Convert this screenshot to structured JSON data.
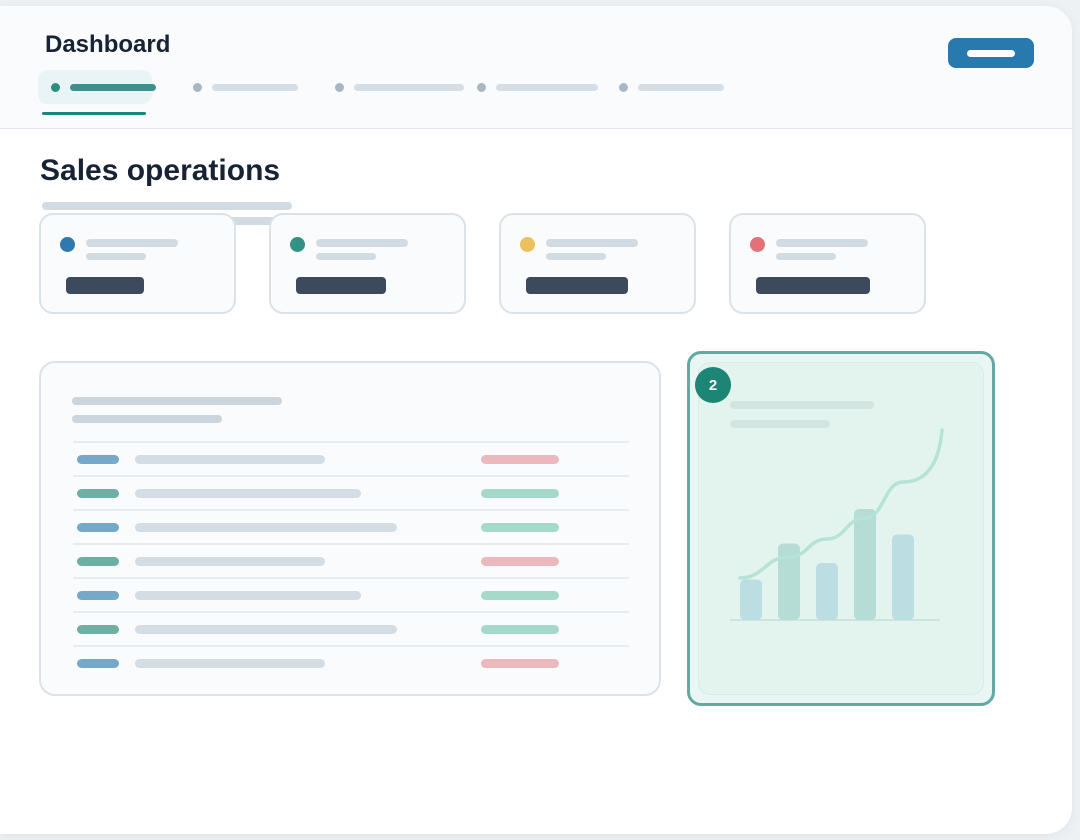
{
  "app": {
    "title": "Dashboard"
  },
  "page": {
    "title": "Sales operations"
  },
  "annotation": {
    "badge": "2"
  },
  "colors": {
    "primary": "#2879ae",
    "accent": "#1e8679",
    "status_blue": "#2f79ae",
    "status_teal": "#329285",
    "status_yellow": "#ecc15d",
    "status_red": "#e47078",
    "tag_blue": "#76a8c9",
    "tag_teal": "#6eafa3",
    "pill_red": "#eab8bd",
    "pill_green": "#a5dacb"
  },
  "icons": {
    "header_action": "primary-action-button",
    "chart": "bar-line-combo-chart"
  },
  "nav": {
    "tab_count": 5,
    "active_tab": 1
  },
  "stat_cards": [
    {
      "status_color": "#2f79ae"
    },
    {
      "status_color": "#329285"
    },
    {
      "status_color": "#ecc15d"
    },
    {
      "status_color": "#e47078"
    }
  ],
  "table": {
    "rows": [
      {
        "tag": "blue",
        "status": "red"
      },
      {
        "tag": "teal",
        "status": "green"
      },
      {
        "tag": "blue",
        "status": "green"
      },
      {
        "tag": "teal",
        "status": "red"
      },
      {
        "tag": "blue",
        "status": "green"
      },
      {
        "tag": "teal",
        "status": "green"
      },
      {
        "tag": "blue",
        "status": "red"
      }
    ]
  },
  "chart_data": {
    "type": "bar",
    "categories": [
      "",
      "",
      "",
      "",
      ""
    ],
    "series": [
      {
        "type": "bar",
        "values": [
          27,
          51,
          38,
          74,
          57
        ]
      },
      {
        "type": "line",
        "values": [
          28,
          42,
          54,
          68,
          92
        ]
      }
    ],
    "title": "",
    "xlabel": "",
    "ylabel": "",
    "ylim": [
      0,
      100
    ],
    "grid": false,
    "legend": "none"
  }
}
